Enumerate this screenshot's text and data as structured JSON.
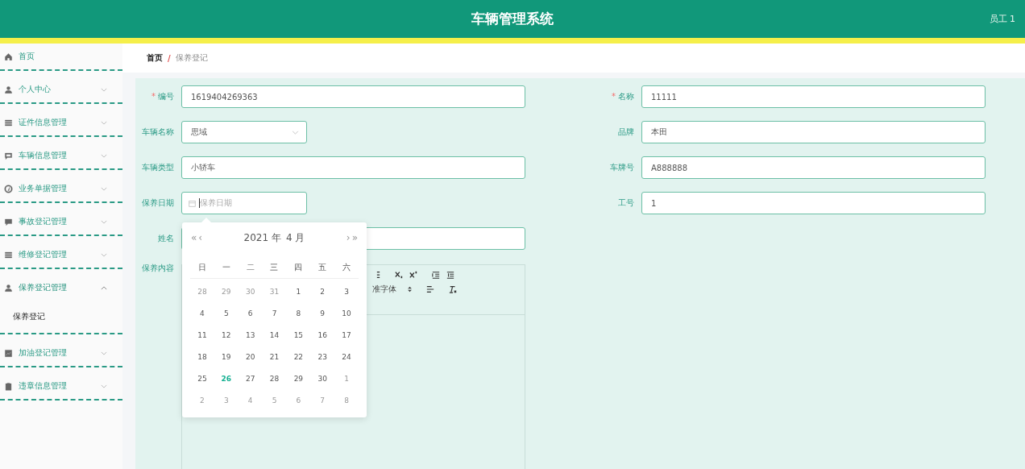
{
  "header": {
    "title": "车辆管理系统",
    "user": "员工 1"
  },
  "sidebar": {
    "items": [
      {
        "label": "首页",
        "expandable": false
      },
      {
        "label": "个人中心",
        "expandable": true,
        "expanded": false
      },
      {
        "label": "证件信息管理",
        "expandable": true,
        "expanded": false
      },
      {
        "label": "车辆信息管理",
        "expandable": true,
        "expanded": false
      },
      {
        "label": "业务单据管理",
        "expandable": true,
        "expanded": false
      },
      {
        "label": "事故登记管理",
        "expandable": true,
        "expanded": false
      },
      {
        "label": "维修登记管理",
        "expandable": true,
        "expanded": false
      },
      {
        "label": "保养登记管理",
        "expandable": true,
        "expanded": true,
        "children": [
          {
            "label": "保养登记"
          }
        ]
      },
      {
        "label": "加油登记管理",
        "expandable": true,
        "expanded": false
      },
      {
        "label": "违章信息管理",
        "expandable": true,
        "expanded": false
      }
    ]
  },
  "breadcrumb": {
    "separator": "/",
    "items": [
      "首页",
      "保养登记"
    ]
  },
  "form": {
    "required_mark": "*",
    "fields": [
      {
        "label": "编号",
        "required": true,
        "kind": "text",
        "value": "1619404269363"
      },
      {
        "label": "名称",
        "required": true,
        "kind": "text",
        "value": "11111"
      },
      {
        "label": "车辆名称",
        "required": false,
        "kind": "select",
        "value": "思域"
      },
      {
        "label": "品牌",
        "required": false,
        "kind": "text",
        "value": "本田"
      },
      {
        "label": "车辆类型",
        "required": false,
        "kind": "text",
        "value": "小轿车"
      },
      {
        "label": "车牌号",
        "required": false,
        "kind": "text",
        "value": "A888888"
      },
      {
        "label": "保养日期",
        "required": false,
        "kind": "date",
        "placeholder": "保养日期"
      },
      {
        "label": "工号",
        "required": false,
        "kind": "text",
        "value": "1"
      },
      {
        "label": "姓名",
        "required": false,
        "kind": "text"
      }
    ],
    "editor": {
      "label": "保养内容",
      "font": "准字体"
    }
  },
  "datepicker": {
    "year": "2021 年",
    "month": "4 月",
    "prev_year": "«",
    "prev_month": "‹",
    "next_month": "›",
    "next_year": "»",
    "weekdays": [
      "日",
      "一",
      "二",
      "三",
      "四",
      "五",
      "六"
    ],
    "weeks": [
      [
        {
          "d": "28",
          "muted": true,
          "today": false
        },
        {
          "d": "29",
          "muted": true,
          "today": false
        },
        {
          "d": "30",
          "muted": true,
          "today": false
        },
        {
          "d": "31",
          "muted": true,
          "today": false
        },
        {
          "d": "1",
          "muted": false,
          "today": false
        },
        {
          "d": "2",
          "muted": false,
          "today": false
        },
        {
          "d": "3",
          "muted": false,
          "today": false
        }
      ],
      [
        {
          "d": "4",
          "muted": false,
          "today": false
        },
        {
          "d": "5",
          "muted": false,
          "today": false
        },
        {
          "d": "6",
          "muted": false,
          "today": false
        },
        {
          "d": "7",
          "muted": false,
          "today": false
        },
        {
          "d": "8",
          "muted": false,
          "today": false
        },
        {
          "d": "9",
          "muted": false,
          "today": false
        },
        {
          "d": "10",
          "muted": false,
          "today": false
        }
      ],
      [
        {
          "d": "11",
          "muted": false,
          "today": false
        },
        {
          "d": "12",
          "muted": false,
          "today": false
        },
        {
          "d": "13",
          "muted": false,
          "today": false
        },
        {
          "d": "14",
          "muted": false,
          "today": false
        },
        {
          "d": "15",
          "muted": false,
          "today": false
        },
        {
          "d": "16",
          "muted": false,
          "today": false
        },
        {
          "d": "17",
          "muted": false,
          "today": false
        }
      ],
      [
        {
          "d": "18",
          "muted": false,
          "today": false
        },
        {
          "d": "19",
          "muted": false,
          "today": false
        },
        {
          "d": "20",
          "muted": false,
          "today": false
        },
        {
          "d": "21",
          "muted": false,
          "today": false
        },
        {
          "d": "22",
          "muted": false,
          "today": false
        },
        {
          "d": "23",
          "muted": false,
          "today": false
        },
        {
          "d": "24",
          "muted": false,
          "today": false
        }
      ],
      [
        {
          "d": "25",
          "muted": false,
          "today": false
        },
        {
          "d": "26",
          "muted": false,
          "today": true
        },
        {
          "d": "27",
          "muted": false,
          "today": false
        },
        {
          "d": "28",
          "muted": false,
          "today": false
        },
        {
          "d": "29",
          "muted": false,
          "today": false
        },
        {
          "d": "30",
          "muted": false,
          "today": false
        },
        {
          "d": "1",
          "muted": true,
          "today": false
        }
      ],
      [
        {
          "d": "2",
          "muted": true,
          "today": false
        },
        {
          "d": "3",
          "muted": true,
          "today": false
        },
        {
          "d": "4",
          "muted": true,
          "today": false
        },
        {
          "d": "5",
          "muted": true,
          "today": false
        },
        {
          "d": "6",
          "muted": true,
          "today": false
        },
        {
          "d": "7",
          "muted": true,
          "today": false
        },
        {
          "d": "8",
          "muted": true,
          "today": false
        }
      ]
    ]
  }
}
